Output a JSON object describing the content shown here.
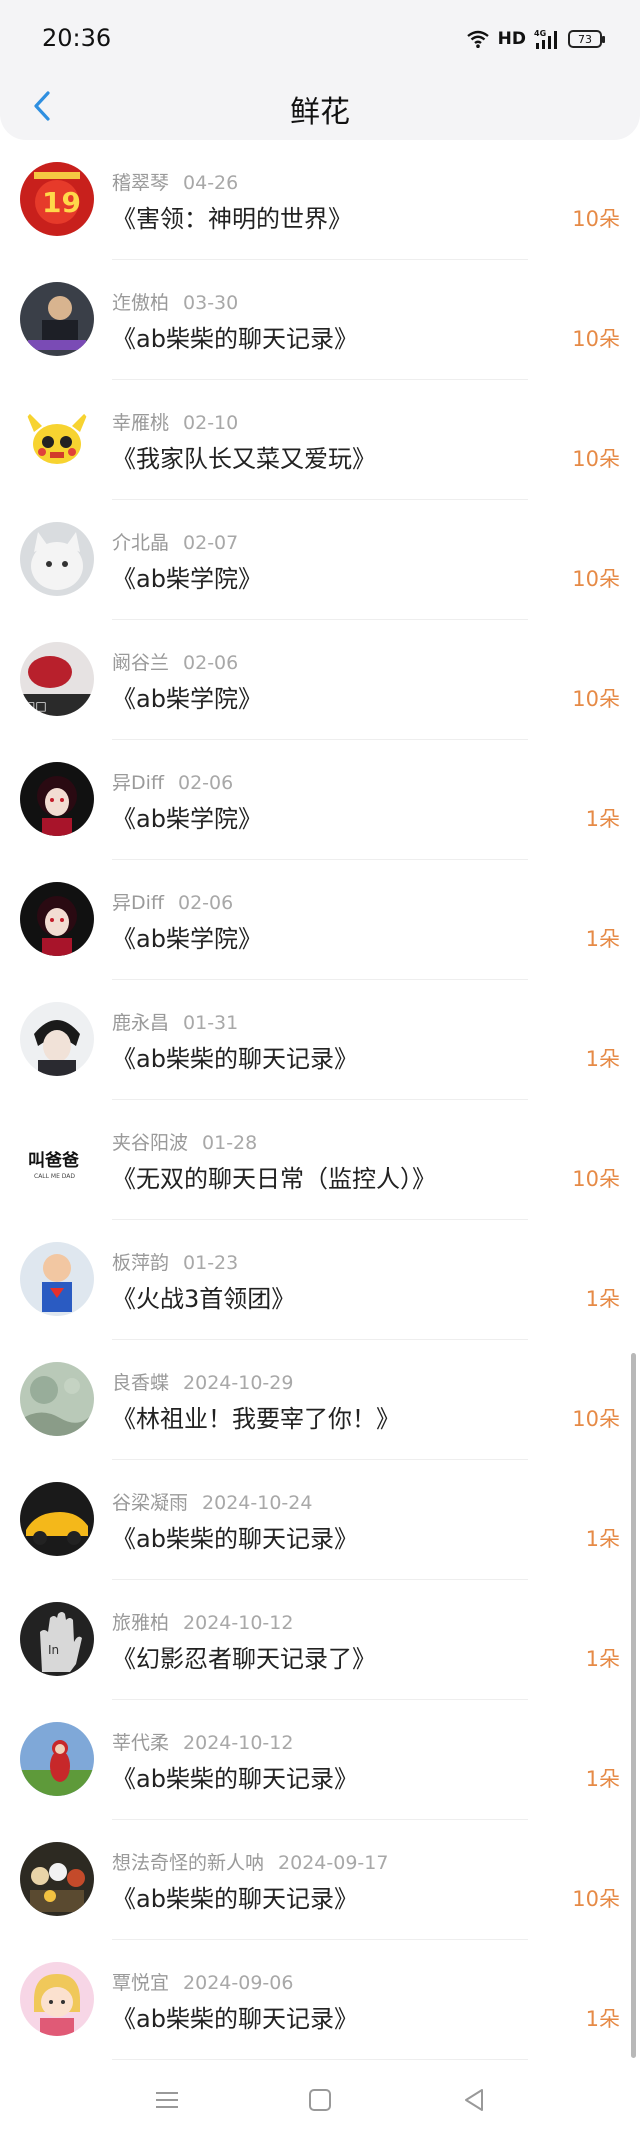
{
  "status_bar": {
    "time": "20:36",
    "network": "HD",
    "signal": "4G",
    "battery": "73"
  },
  "header": {
    "title": "鲜花",
    "back_icon": "chevron-left-icon",
    "accent": "#2f8fe0"
  },
  "colors": {
    "count": "#e68a46",
    "meta": "#9a9a9a"
  },
  "items": [
    {
      "user": "稽翠琴",
      "date": "04-26",
      "title": "《害领：神明的世界》",
      "count": "10朵",
      "avatar": "red-logo"
    },
    {
      "user": "迮傲柏",
      "date": "03-30",
      "title": "《ab柴柴的聊天记录》",
      "count": "10朵",
      "avatar": "person-photo"
    },
    {
      "user": "幸雁桃",
      "date": "02-10",
      "title": "《我家队长又菜又爱玩》",
      "count": "10朵",
      "avatar": "pikachu"
    },
    {
      "user": "介北晶",
      "date": "02-07",
      "title": "《ab柴学院》",
      "count": "10朵",
      "avatar": "white-cat"
    },
    {
      "user": "阚谷兰",
      "date": "02-06",
      "title": "《ab柴学院》",
      "count": "10朵",
      "avatar": "red-object"
    },
    {
      "user": "异Diff",
      "date": "02-06",
      "title": "《ab柴学院》",
      "count": "1朵",
      "avatar": "anime-girl"
    },
    {
      "user": "异Diff",
      "date": "02-06",
      "title": "《ab柴学院》",
      "count": "1朵",
      "avatar": "anime-girl"
    },
    {
      "user": "鹿永昌",
      "date": "01-31",
      "title": "《ab柴柴的聊天记录》",
      "count": "1朵",
      "avatar": "anime-boy"
    },
    {
      "user": "夹谷阳波",
      "date": "01-28",
      "title": "《无双的聊天日常（监控人）》",
      "count": "10朵",
      "avatar": "text-logo",
      "avatar_text": "叫爸爸"
    },
    {
      "user": "板萍韵",
      "date": "01-23",
      "title": "《火战3首领团》",
      "count": "1朵",
      "avatar": "superman-baby"
    },
    {
      "user": "良香蝶",
      "date": "2024-10-29",
      "title": "《林祖业！我要宰了你！》",
      "count": "10朵",
      "avatar": "painting"
    },
    {
      "user": "谷梁凝雨",
      "date": "2024-10-24",
      "title": "《ab柴柴的聊天记录》",
      "count": "1朵",
      "avatar": "yellow-car"
    },
    {
      "user": "旅雅柏",
      "date": "2024-10-12",
      "title": "《幻影忍者聊天记录了》",
      "count": "1朵",
      "avatar": "hand-bw"
    },
    {
      "user": "莘代柔",
      "date": "2024-10-12",
      "title": "《ab柴柴的聊天记录》",
      "count": "1朵",
      "avatar": "teletubby"
    },
    {
      "user": "想法奇怪的新人呐",
      "date": "2024-09-17",
      "title": "《ab柴柴的聊天记录》",
      "count": "10朵",
      "avatar": "group-photo"
    },
    {
      "user": "覃悦宜",
      "date": "2024-09-06",
      "title": "《ab柴柴的聊天记录》",
      "count": "1朵",
      "avatar": "cartoon-girl"
    }
  ],
  "system_nav": {
    "menu_icon": "menu-icon",
    "home_icon": "home-square-icon",
    "back_icon": "back-triangle-icon"
  }
}
